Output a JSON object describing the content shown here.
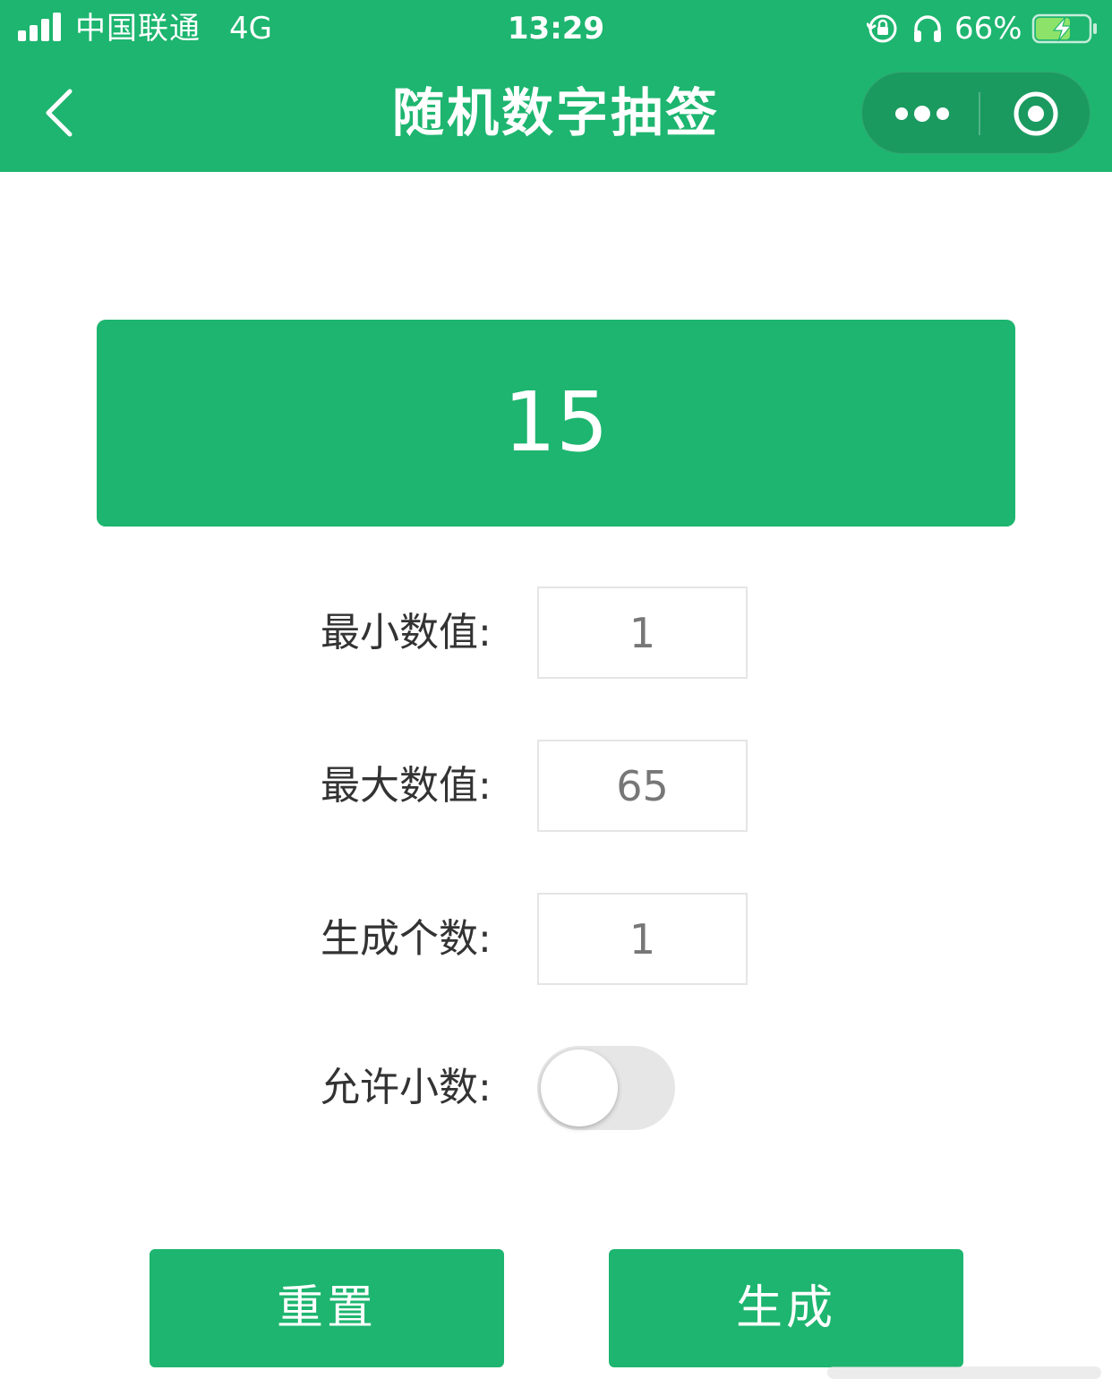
{
  "status_bar": {
    "carrier": "中国联通",
    "network": "4G",
    "time": "13:29",
    "battery_percent": "66%",
    "battery_level": 0.66,
    "icons": [
      "signal-icon",
      "rotation-lock-icon",
      "headphones-icon",
      "battery-charging-icon"
    ]
  },
  "nav": {
    "title": "随机数字抽签",
    "back_icon": "chevron-left-icon",
    "capsule_icons": [
      "more-dots-icon",
      "close-target-icon"
    ]
  },
  "result": {
    "value": "15"
  },
  "form": {
    "min_label": "最小数值:",
    "min_value": "1",
    "max_label": "最大数值:",
    "max_value": "65",
    "count_label": "生成个数:",
    "count_value": "1",
    "decimal_label": "允许小数:",
    "decimal_enabled": false
  },
  "buttons": {
    "reset": "重置",
    "generate": "生成"
  },
  "colors": {
    "brand_green": "#1db56f",
    "capsule_green": "#1a9a5f",
    "toggle_off": "#e6e6e6",
    "label_text": "#333333",
    "input_text": "#777777"
  }
}
